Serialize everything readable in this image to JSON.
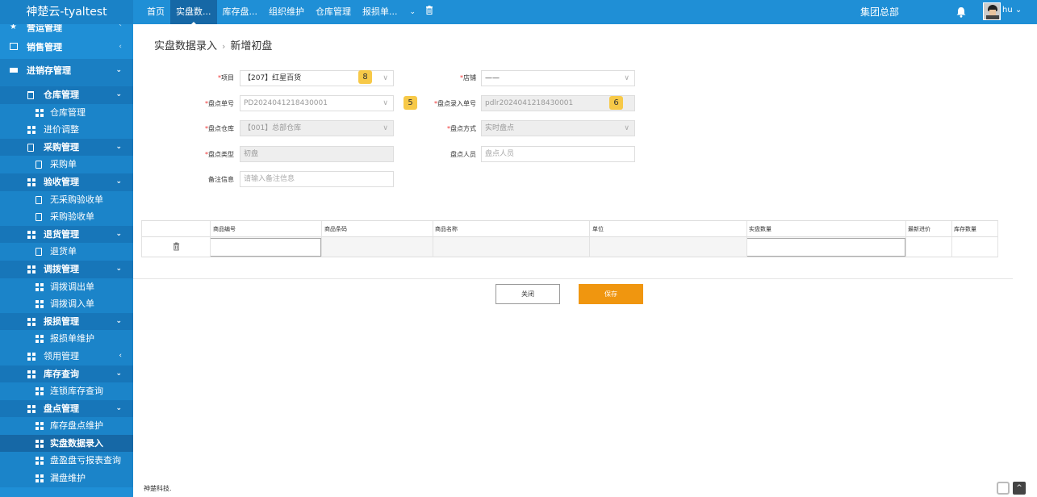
{
  "app": {
    "title": "神楚云-tyaltest",
    "org": "集团总部",
    "user": "hu"
  },
  "topnav": [
    "首页",
    "实盘数...",
    "库存盘...",
    "组织维护",
    "仓库管理",
    "报损单..."
  ],
  "topnav_more": "⌄",
  "sidebar": {
    "yingyun": "营运管理",
    "xiaoshou": "销售管理",
    "jxc": "进销存管理",
    "items": [
      {
        "label": "仓库管理",
        "level": 1
      },
      {
        "label": "仓库管理",
        "level": 2
      },
      {
        "label": "进价调整",
        "level": 1
      },
      {
        "label": "采购管理",
        "level": 1
      },
      {
        "label": "采购单",
        "level": 2
      },
      {
        "label": "验收管理",
        "level": 1
      },
      {
        "label": "无采购验收单",
        "level": 2
      },
      {
        "label": "采购验收单",
        "level": 2
      },
      {
        "label": "退货管理",
        "level": 1
      },
      {
        "label": "退货单",
        "level": 2
      },
      {
        "label": "调拨管理",
        "level": 1
      },
      {
        "label": "调拨调出单",
        "level": 2
      },
      {
        "label": "调拨调入单",
        "level": 2
      },
      {
        "label": "报损管理",
        "level": 1
      },
      {
        "label": "报损单维护",
        "level": 2
      },
      {
        "label": "领用管理",
        "level": 1
      },
      {
        "label": "库存查询",
        "level": 1
      },
      {
        "label": "连锁库存查询",
        "level": 2
      },
      {
        "label": "盘点管理",
        "level": 1
      },
      {
        "label": "库存盘点维护",
        "level": 2
      },
      {
        "label": "实盘数据录入",
        "level": 2
      },
      {
        "label": "盘盈盘亏报表查询",
        "level": 2
      },
      {
        "label": "漏盘维护",
        "level": 2
      }
    ]
  },
  "breadcrumb": {
    "parent": "实盘数据录入",
    "sep": "›",
    "current": "新增初盘"
  },
  "form": {
    "project_label": "项目",
    "project_value": "【207】红星百货",
    "project_badge": "8",
    "store_label": "店铺",
    "store_value": "——",
    "order_label": "盘点单号",
    "order_value": "PD2024041218430001",
    "order_badge": "5",
    "entry_label": "盘点录入单号",
    "entry_value": "pdlr2024041218430001",
    "entry_badge": "6",
    "warehouse_label": "盘点仓库",
    "warehouse_value": "【001】总部仓库",
    "method_label": "盘点方式",
    "method_value": "实时盘点",
    "type_label": "盘点类型",
    "type_value": "初盘",
    "staff_label": "盘点人员",
    "staff_placeholder": "盘点人员",
    "remark_label": "备注信息",
    "remark_placeholder": "请输入备注信息"
  },
  "table": {
    "headers": [
      "商品编号",
      "商品条码",
      "商品名称",
      "单位",
      "实盘数量",
      "最新进价",
      "库存数量"
    ]
  },
  "buttons": {
    "close": "关闭",
    "save": "保存"
  },
  "footer": "神楚科技."
}
